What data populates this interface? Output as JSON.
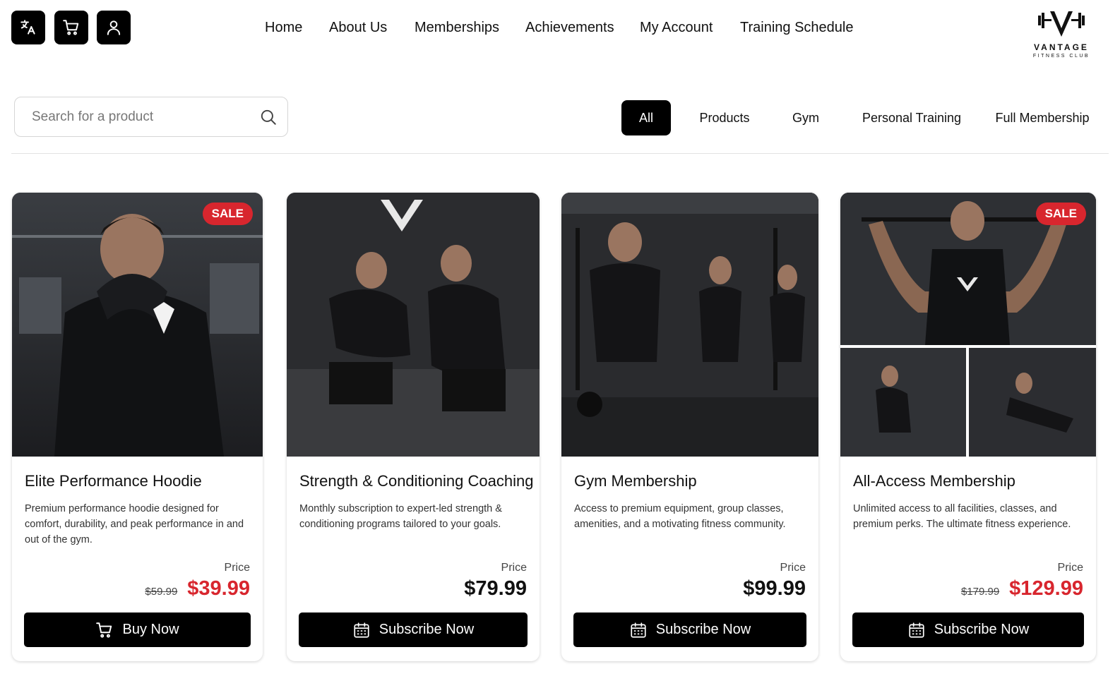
{
  "header": {
    "icons": [
      "translate-icon",
      "cart-icon",
      "user-icon"
    ],
    "nav": [
      "Home",
      "About Us",
      "Memberships",
      "Achievements",
      "My Account",
      "Training Schedule"
    ],
    "logo": {
      "brand": "VANTAGE",
      "sub": "FITNESS CLUB"
    }
  },
  "search": {
    "placeholder": "Search for a product",
    "value": ""
  },
  "filters": {
    "items": [
      "All",
      "Products",
      "Gym",
      "Personal Training",
      "Full Membership"
    ],
    "active": "All"
  },
  "products": [
    {
      "title": "Elite Performance Hoodie",
      "description": "Premium performance hoodie designed for comfort, durability, and peak performance in and out of the gym.",
      "price_label": "Price",
      "old_price": "$59.99",
      "price": "$39.99",
      "badge": "SALE",
      "action": "Buy Now",
      "action_icon": "cart-icon"
    },
    {
      "title": "Strength & Conditioning Coaching",
      "description": "Monthly subscription to expert-led strength & conditioning programs tailored to your goals.",
      "price_label": "Price",
      "old_price": "",
      "price": "$79.99",
      "badge": "",
      "action": "Subscribe Now",
      "action_icon": "calendar-icon"
    },
    {
      "title": "Gym Membership",
      "description": "Access to premium equipment, group classes, amenities, and a motivating fitness community.",
      "price_label": "Price",
      "old_price": "",
      "price": "$99.99",
      "badge": "",
      "action": "Subscribe Now",
      "action_icon": "calendar-icon"
    },
    {
      "title": "All-Access Membership",
      "description": "Unlimited access to all facilities, classes, and premium perks. The ultimate fitness experience.",
      "price_label": "Price",
      "old_price": "$179.99",
      "price": "$129.99",
      "badge": "SALE",
      "action": "Subscribe Now",
      "action_icon": "calendar-icon"
    }
  ],
  "colors": {
    "accent": "#000000",
    "sale": "#d8262e",
    "border": "#e2e2e2"
  }
}
